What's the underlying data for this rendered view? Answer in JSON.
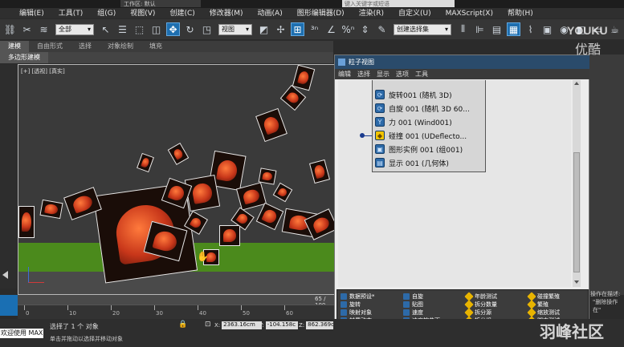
{
  "title_bar": {
    "workspace": "工作区: 默认",
    "search_placeholder": "键入关键字或短语"
  },
  "menu": [
    "编辑(E)",
    "工具(T)",
    "组(G)",
    "视图(V)",
    "创建(C)",
    "修改器(M)",
    "动画(A)",
    "图形编辑器(D)",
    "渲染(R)",
    "自定义(U)",
    "MAXScript(X)",
    "帮助(H)"
  ],
  "toolbar": {
    "selection_filter": "全部",
    "ref_coord": "视图",
    "named_selection": "创建选择集"
  },
  "ribbon_tabs": [
    "建模",
    "自由形式",
    "选择",
    "对象绘制",
    "填充"
  ],
  "ribbon_sub": "多边形建模",
  "viewport": {
    "label": "[+] [透视] [真实]",
    "frame_counter": "65 / 100"
  },
  "particle_view": {
    "title": "粒子视图",
    "menu": [
      "编辑",
      "选择",
      "显示",
      "选项",
      "工具"
    ],
    "events": [
      {
        "label": "旋转001 (随机 3D)",
        "icon": "spin-icon"
      },
      {
        "label": "自旋 001 (随机 3D 60...",
        "icon": "spin-icon"
      },
      {
        "label": "力 001 (Wind001)",
        "icon": "force-icon"
      },
      {
        "label": "碰撞 001 (UDeflecto...",
        "icon": "collision-icon"
      },
      {
        "label": "图形实例 001 (组001)",
        "icon": "shape-instance-icon"
      },
      {
        "label": "显示 001 (几何体)",
        "icon": "display-icon"
      }
    ],
    "depot": [
      [
        "数据预设*",
        "旋转",
        "映射对象",
        "材质动态",
        "材质静态",
        "材质频率"
      ],
      [
        "自旋",
        "贴图",
        "速度",
        "速度按曲面",
        "mP 碰撞*",
        "mP 粒子间碰撞*"
      ],
      [
        "年龄测试",
        "拆分数量",
        "拆分源",
        "拆分组",
        "拆分选定项",
        "数据图标测试*"
      ],
      [
        "碰撞繁殖",
        "繁殖",
        "缩放测试",
        "脚本测试",
        "速度测试",
        "查找目标"
      ]
    ]
  },
  "timeline": {
    "ticks": [
      "0",
      "10",
      "20",
      "30",
      "40",
      "50",
      "60"
    ]
  },
  "status": {
    "welcome": "欢迎使用 MAX",
    "selected": "选择了 1 个 对象",
    "prompt": "单击并拖动以选择并移动对象",
    "x_label": "X:",
    "x_value": "2363.16cm",
    "y_label": "Y:",
    "y_value": "-104.158c",
    "z_label": "Z:",
    "z_value": "862.369cm",
    "right_label": "操作在描述:",
    "right_value": "\"删除操作在\""
  },
  "watermarks": {
    "youku": "YOUKU",
    "youku_cn": "优酷",
    "bottom": "羽峰社区"
  },
  "colors": {
    "accent": "#1e6fb0",
    "viewport_bg": "#3a3a3a",
    "ground": "#4b8a1c",
    "event_bg": "#d6d6d6"
  }
}
